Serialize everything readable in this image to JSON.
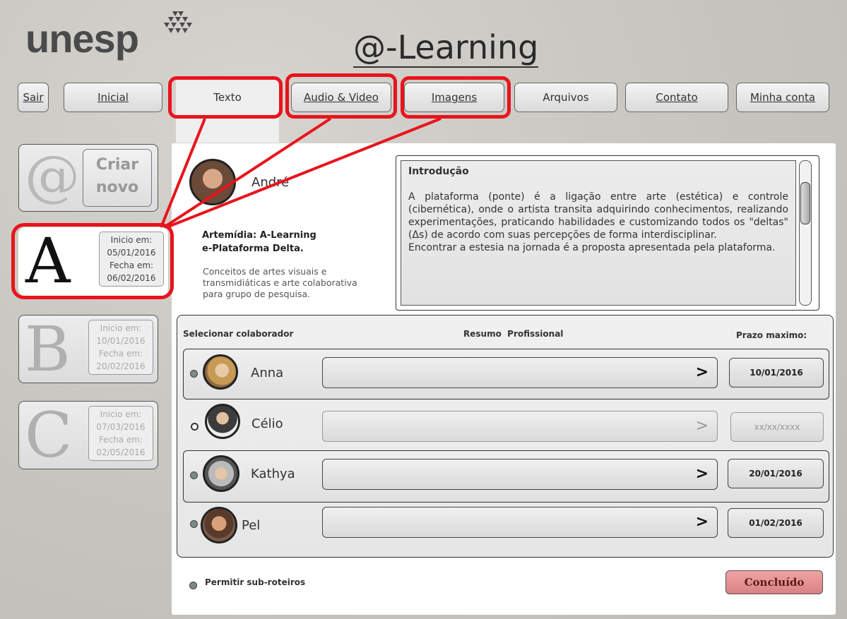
{
  "brand": {
    "logo_text": "unesp",
    "app_title": "@-Learning"
  },
  "nav": {
    "sair": "Sair",
    "inicial": "Inicial",
    "texto": "Texto",
    "audio_video": "Audio & Video",
    "imagens": "Imagens",
    "arquivos": "Arquivos",
    "contato": "Contato",
    "minha_conta": "Minha conta"
  },
  "sidebar": {
    "new": {
      "symbol": "@",
      "label_line1": "Criar",
      "label_line2": "novo"
    },
    "scripts": [
      {
        "letter": "A",
        "start_label": "Inicio em:",
        "start": "05/01/2016",
        "end_label": "Fecha em:",
        "end": "06/02/2016"
      },
      {
        "letter": "B",
        "start_label": "Inicio em:",
        "start": "10/01/2016",
        "end_label": "Fecha em:",
        "end": "20/02/2016"
      },
      {
        "letter": "C",
        "start_label": "Inicio em:",
        "start": "07/03/2016",
        "end_label": "Fecha em:",
        "end": "02/05/2016"
      }
    ]
  },
  "author": {
    "name": "André"
  },
  "project": {
    "title_line1": "Artemídia: A-Learning",
    "title_line2": "e-Plataforma Delta.",
    "desc_line1": "Conceitos de artes visuais e",
    "desc_line2": "transmidiáticas e arte colaborativa",
    "desc_line3": "para grupo de pesquisa."
  },
  "intro": {
    "heading": "Introdução",
    "p1": "A plataforma (ponte) é a ligação entre arte (estética) e controle (cibernética), onde o artista transita adquirindo conhecimentos, realizando experimentações, praticando habilidades e customizando todos os \"deltas\" (Δs) de acordo com suas percepções de forma interdisciplinar.",
    "p2": "Encontrar a estesia na jornada é a proposta apresentada pela plataforma."
  },
  "collaborators": {
    "col_select": "Selecionar colaborador",
    "col_resumo": "Resumo  Profissional",
    "col_prazo": "Prazo maximo:",
    "rows": [
      {
        "name": "Anna",
        "deadline": "10/01/2016"
      },
      {
        "name": "Célio",
        "deadline": "xx/xx/xxxx"
      },
      {
        "name": "Kathya",
        "deadline": "20/01/2016"
      },
      {
        "name": "Pel",
        "deadline": "01/02/2016"
      }
    ]
  },
  "footer": {
    "permit_label": "Permitir sub-roteiros",
    "done_label": "Concluído"
  },
  "colors": {
    "highlight": "#e8141c",
    "done_button": "#e09090"
  }
}
